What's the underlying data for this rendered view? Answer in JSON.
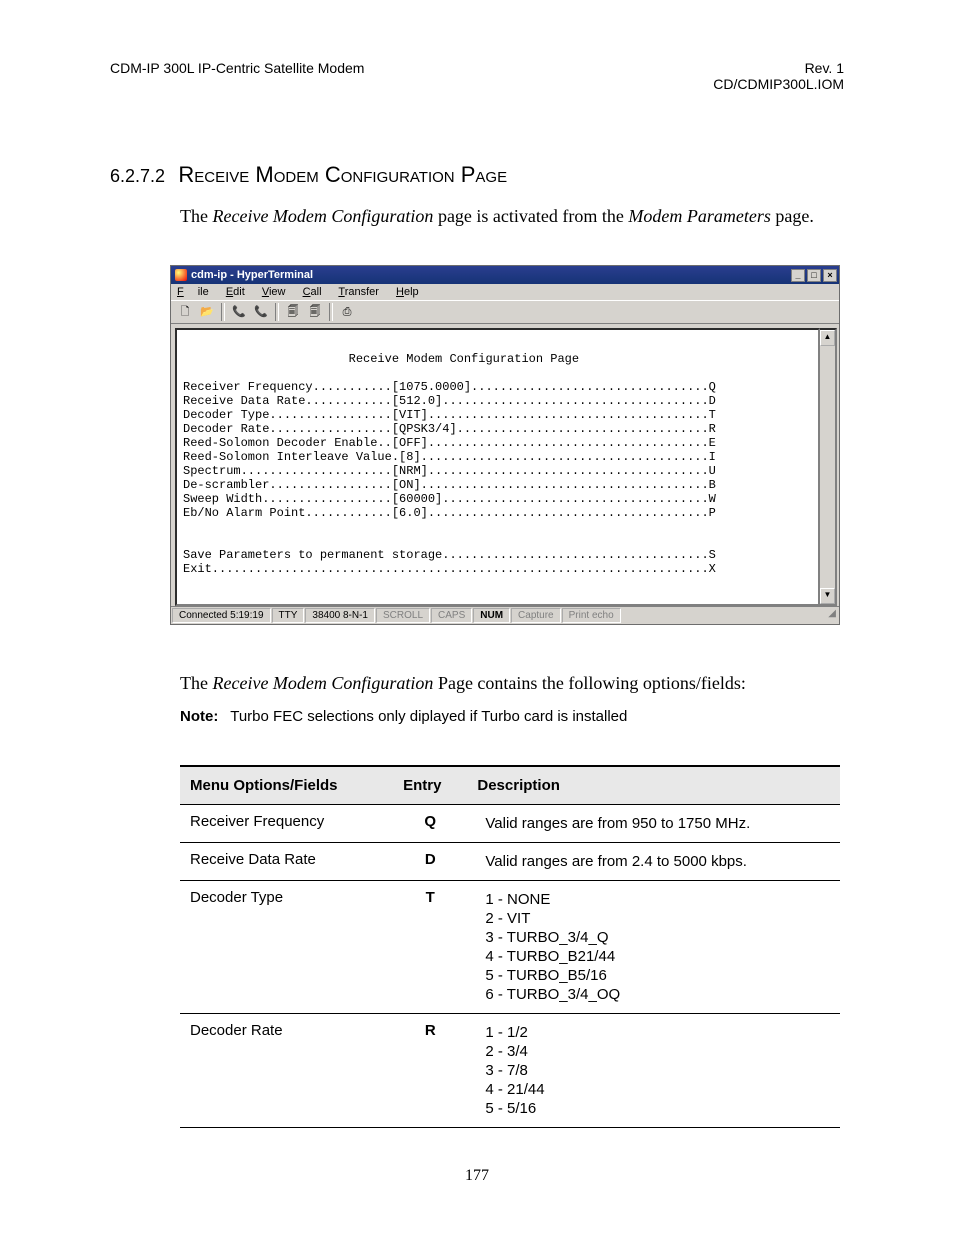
{
  "header": {
    "left": "CDM-IP 300L IP-Centric Satellite Modem",
    "right1": "Rev. 1",
    "right2": "CD/CDMIP300L.IOM"
  },
  "section": {
    "number": "6.2.7.2",
    "title": "Receive Modem Configuration Page",
    "intro_pre": "The ",
    "intro_em1": "Receive Modem Configuration",
    "intro_mid": " page is activated from the ",
    "intro_em2": "Modem Parameters",
    "intro_post": " page."
  },
  "ht": {
    "title": "cdm-ip - HyperTerminal",
    "menu": {
      "file": "File",
      "edit": "Edit",
      "view": "View",
      "call": "Call",
      "transfer": "Transfer",
      "help": "Help"
    },
    "sys": {
      "min": "_",
      "max": "□",
      "close": "×"
    },
    "toolbar": {
      "b1": "🗋",
      "b2": "📂",
      "b3": "📞",
      "b4": "📞",
      "b5": "🗐",
      "b6": "🗐",
      "b7": "⎙"
    },
    "term_heading": "Receive Modem Configuration Page",
    "lines": [
      "Receiver Frequency...........[1075.0000].................................Q",
      "Receive Data Rate............[512.0].....................................D",
      "Decoder Type.................[VIT].......................................T",
      "Decoder Rate.................[QPSK3/4]...................................R",
      "Reed-Solomon Decoder Enable..[OFF].......................................E",
      "Reed-Solomon Interleave Value.[8]........................................I",
      "Spectrum.....................[NRM].......................................U",
      "De-scrambler.................[ON]........................................B",
      "Sweep Width..................[60000].....................................W",
      "Eb/No Alarm Point............[6.0].......................................P",
      "",
      "",
      "Save Parameters to permanent storage.....................................S",
      "Exit.....................................................................X"
    ],
    "status": {
      "conn": "Connected 5:19:19",
      "tty": "TTY",
      "baud": "38400 8-N-1",
      "scroll": "SCROLL",
      "caps": "CAPS",
      "num": "NUM",
      "capture": "Capture",
      "echo": "Print echo"
    },
    "scroll": {
      "up": "▲",
      "down": "▼"
    }
  },
  "after": {
    "p1_pre": "The ",
    "p1_em": "Receive Modem Configuration",
    "p1_post": " Page contains the following options/fields:",
    "note_label": "Note:",
    "note_text": "Turbo FEC selections only diplayed if Turbo card is installed"
  },
  "table": {
    "h1": "Menu Options/Fields",
    "h2": "Entry",
    "h3": "Description",
    "rows": [
      {
        "opt": "Receiver Frequency",
        "entry": "Q",
        "desc": [
          "Valid ranges are from 950 to 1750 MHz."
        ]
      },
      {
        "opt": "Receive Data Rate",
        "entry": "D",
        "desc": [
          "Valid ranges are from 2.4 to 5000 kbps."
        ]
      },
      {
        "opt": "Decoder Type",
        "entry": "T",
        "desc": [
          "1 - NONE",
          "2 - VIT",
          "3 - TURBO_3/4_Q",
          "4 - TURBO_B21/44",
          "5 - TURBO_B5/16",
          "6 - TURBO_3/4_OQ"
        ]
      },
      {
        "opt": "Decoder Rate",
        "entry": "R",
        "desc": [
          "1 - 1/2",
          "2 - 3/4",
          "3 - 7/8",
          "4 - 21/44",
          "5 - 5/16"
        ]
      }
    ]
  },
  "pagenum": "177"
}
